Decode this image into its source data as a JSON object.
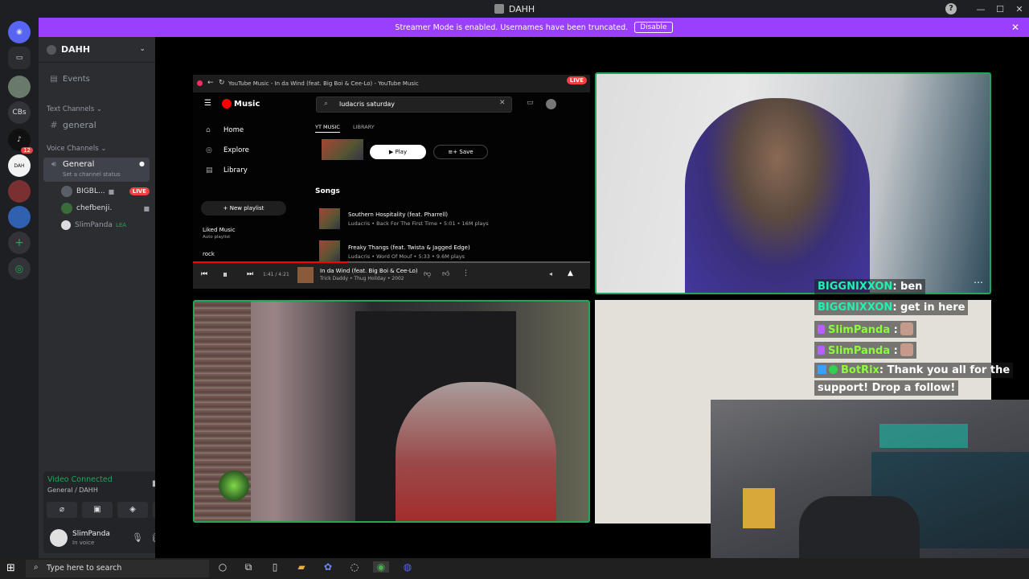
{
  "app": {
    "title": "DAHH"
  },
  "banner": {
    "message": "Streamer Mode is enabled. Usernames have been truncated.",
    "disable_label": "Disable",
    "color": "#9a3ffd"
  },
  "rail": {
    "servers": [
      "CBs"
    ],
    "badge": "12"
  },
  "sidebar": {
    "server_name": "DAHH",
    "events_label": "Events",
    "text_category": "Text Channels",
    "text_channels": [
      "general"
    ],
    "voice_category": "Voice Channels",
    "voice_channel": {
      "name": "General",
      "status_placeholder": "Set a channel status"
    },
    "voice_users": [
      {
        "name": "BIGBL...",
        "live": "LIVE"
      },
      {
        "name": "chefbenji."
      },
      {
        "name": "SlimPanda",
        "tag": "LEA"
      }
    ]
  },
  "voice_panel": {
    "title": "Video Connected",
    "location": "General / DAHH"
  },
  "user_panel": {
    "name": "SlimPanda",
    "status": "In voice"
  },
  "ytmusic": {
    "window_title": "YouTube Music - In da Wind (feat. Big Boi & Cee-Lo) - YouTube Music",
    "live_label": "LIVE",
    "logo": "Music",
    "search_value": "ludacris saturday",
    "nav": [
      "Home",
      "Explore",
      "Library"
    ],
    "new_playlist": "New playlist",
    "liked": {
      "title": "Liked Music",
      "sub": "Auto playlist"
    },
    "playlist_rock": "rock",
    "tabs": [
      "YT MUSIC",
      "LIBRARY"
    ],
    "play_label": "Play",
    "save_label": "Save",
    "songs_heading": "Songs",
    "songs": [
      {
        "title": "Southern Hospitality (feat. Pharrell)",
        "meta": "Ludacris • Back For The First Time • 5:01 • 16M plays"
      },
      {
        "title": "Freaky Thangs (feat. Twista & Jagged Edge)",
        "meta": "Ludacris • Word Of Mouf • 5:33 • 9.6M plays"
      }
    ],
    "player": {
      "time": "1:41 / 4:21",
      "progress": 0.39,
      "now_title": "In da Wind (feat. Big Boi & Cee-Lo)",
      "now_meta": "Trick Daddy • Thug Holiday • 2002"
    }
  },
  "chat": [
    {
      "user": "BIGGNIXXON",
      "text": ": ben",
      "style": "u1"
    },
    {
      "user": "BIGGNIXXON",
      "text": ": get in here",
      "style": "u1"
    },
    {
      "user": "SlimPanda",
      "text": ":",
      "style": "u2",
      "gem": true,
      "emote": true
    },
    {
      "user": "SlimPanda",
      "text": ":",
      "style": "u2",
      "gem": true,
      "emote": true
    },
    {
      "user": "BotRix",
      "text": ": Thank you all for the",
      "style": "u2",
      "bot": true
    },
    {
      "user": "",
      "text": "support! Drop a follow!",
      "style": "u2"
    }
  ],
  "taskbar": {
    "search_placeholder": "Type here to search"
  }
}
